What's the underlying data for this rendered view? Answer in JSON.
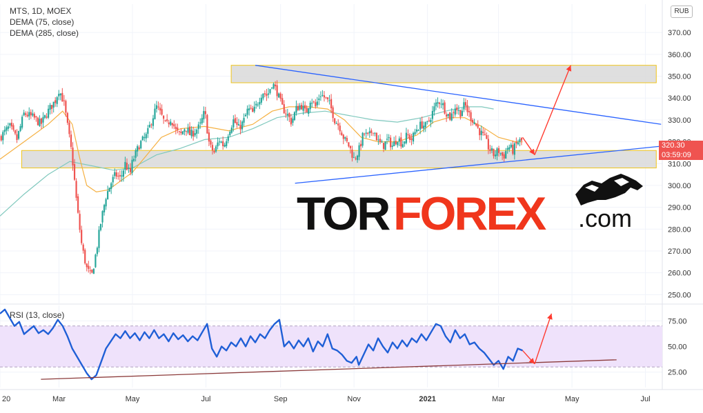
{
  "header": {
    "symbol_line": "MTS, 1D, MOEX",
    "indicator_1": "DEMA (75, close)",
    "indicator_2": "DEMA (285, close)"
  },
  "currency": "RUB",
  "last_price": {
    "value": "320.30",
    "countdown": "03:59:09"
  },
  "watermark": {
    "part1": "TOR",
    "part2": "FOREX",
    "part3": ".com"
  },
  "colors": {
    "candle_up": "#26a69a",
    "candle_down": "#ef5350",
    "dema_fast": "#f5b041",
    "dema_slow": "#7fc8bd",
    "rsi_line": "#1f5fd6",
    "rsi_band": "#efe2fb",
    "trendline": "#2962ff",
    "rsi_trendline": "#8b3a3a",
    "arrow": "#ff3b30",
    "zone_fill": "#d9d9d9",
    "zone_border": "#f0c419",
    "watermark_black": "#111111",
    "watermark_red": "#f0361c"
  },
  "chart_data": [
    {
      "type": "candlestick",
      "title": "MTS, 1D, MOEX",
      "ylabel": "RUB",
      "ylim": [
        246,
        383
      ],
      "y_ticks": [
        250,
        260,
        270,
        280,
        290,
        300,
        310,
        320,
        330,
        340,
        350,
        360,
        370
      ],
      "y_tick_labels": [
        "250.00",
        "260.00",
        "270.00",
        "280.00",
        "290.00",
        "300.00",
        "310.00",
        "320.00",
        "330.00",
        "340.00",
        "350.00",
        "360.00",
        "370.00"
      ],
      "x_ticks": [
        {
          "day": 0,
          "label": "20"
        },
        {
          "day": 49,
          "label": "Mar"
        },
        {
          "day": 110,
          "label": "May"
        },
        {
          "day": 171,
          "label": "Jul"
        },
        {
          "day": 233,
          "label": "Sep"
        },
        {
          "day": 294,
          "label": "Nov"
        },
        {
          "day": 355,
          "label": "2021"
        },
        {
          "day": 414,
          "label": "Mar"
        },
        {
          "day": 475,
          "label": "May"
        },
        {
          "day": 536,
          "label": "Jul"
        }
      ],
      "x_range_days": [
        0,
        550
      ],
      "grid": true,
      "legend": "top-left",
      "close_path": [
        [
          0,
          322
        ],
        [
          8,
          327
        ],
        [
          14,
          321
        ],
        [
          20,
          333
        ],
        [
          28,
          331
        ],
        [
          34,
          328
        ],
        [
          40,
          334
        ],
        [
          46,
          339
        ],
        [
          49,
          344
        ],
        [
          53,
          338
        ],
        [
          57,
          324
        ],
        [
          60,
          313
        ],
        [
          64,
          290
        ],
        [
          68,
          272
        ],
        [
          72,
          262
        ],
        [
          76,
          258
        ],
        [
          80,
          270
        ],
        [
          84,
          284
        ],
        [
          88,
          295
        ],
        [
          92,
          301
        ],
        [
          96,
          305
        ],
        [
          100,
          303
        ],
        [
          104,
          310
        ],
        [
          108,
          305
        ],
        [
          110,
          311
        ],
        [
          116,
          319
        ],
        [
          122,
          323
        ],
        [
          126,
          330
        ],
        [
          130,
          336
        ],
        [
          134,
          332
        ],
        [
          138,
          327
        ],
        [
          142,
          331
        ],
        [
          146,
          325
        ],
        [
          150,
          323
        ],
        [
          154,
          327
        ],
        [
          158,
          323
        ],
        [
          162,
          325
        ],
        [
          166,
          327
        ],
        [
          170,
          334
        ],
        [
          174,
          318
        ],
        [
          178,
          315
        ],
        [
          182,
          321
        ],
        [
          186,
          318
        ],
        [
          190,
          325
        ],
        [
          194,
          330
        ],
        [
          198,
          326
        ],
        [
          202,
          329
        ],
        [
          206,
          335
        ],
        [
          210,
          333
        ],
        [
          214,
          338
        ],
        [
          218,
          343
        ],
        [
          222,
          341
        ],
        [
          226,
          347
        ],
        [
          230,
          343
        ],
        [
          234,
          336
        ],
        [
          238,
          333
        ],
        [
          242,
          329
        ],
        [
          246,
          335
        ],
        [
          250,
          337
        ],
        [
          254,
          333
        ],
        [
          258,
          340
        ],
        [
          262,
          336
        ],
        [
          266,
          342
        ],
        [
          270,
          340
        ],
        [
          274,
          337
        ],
        [
          278,
          330
        ],
        [
          282,
          327
        ],
        [
          286,
          321
        ],
        [
          290,
          318
        ],
        [
          294,
          312
        ],
        [
          298,
          316
        ],
        [
          302,
          324
        ],
        [
          306,
          322
        ],
        [
          310,
          326
        ],
        [
          314,
          320
        ],
        [
          318,
          318
        ],
        [
          322,
          321
        ],
        [
          326,
          318
        ],
        [
          330,
          322
        ],
        [
          334,
          319
        ],
        [
          338,
          323
        ],
        [
          342,
          321
        ],
        [
          346,
          326
        ],
        [
          350,
          328
        ],
        [
          354,
          327
        ],
        [
          358,
          332
        ],
        [
          362,
          337
        ],
        [
          366,
          339
        ],
        [
          370,
          334
        ],
        [
          374,
          331
        ],
        [
          378,
          336
        ],
        [
          382,
          333
        ],
        [
          386,
          337
        ],
        [
          390,
          332
        ],
        [
          394,
          329
        ],
        [
          398,
          325
        ],
        [
          402,
          322
        ],
        [
          406,
          317
        ],
        [
          410,
          314
        ],
        [
          414,
          316
        ],
        [
          418,
          313
        ],
        [
          422,
          318
        ],
        [
          426,
          316
        ],
        [
          430,
          320
        ],
        [
          434,
          320.3
        ]
      ],
      "series": [
        {
          "name": "DEMA (75, close)",
          "points": [
            [
              0,
              312
            ],
            [
              20,
              320
            ],
            [
              40,
              328
            ],
            [
              52,
              334
            ],
            [
              60,
              328
            ],
            [
              66,
              313
            ],
            [
              72,
              300
            ],
            [
              80,
              297
            ],
            [
              90,
              298
            ],
            [
              100,
              302
            ],
            [
              110,
              306
            ],
            [
              122,
              314
            ],
            [
              134,
              322
            ],
            [
              150,
              326
            ],
            [
              170,
              327
            ],
            [
              190,
              325
            ],
            [
              210,
              328
            ],
            [
              226,
              334
            ],
            [
              240,
              336
            ],
            [
              256,
              336
            ],
            [
              272,
              335
            ],
            [
              286,
              330
            ],
            [
              300,
              322
            ],
            [
              314,
              320
            ],
            [
              330,
              320
            ],
            [
              346,
              323
            ],
            [
              360,
              329
            ],
            [
              372,
              331
            ],
            [
              386,
              331
            ],
            [
              400,
              327
            ],
            [
              414,
              322
            ],
            [
              428,
              320
            ],
            [
              434,
              320
            ]
          ]
        },
        {
          "name": "DEMA (285, close)",
          "points": [
            [
              0,
              286
            ],
            [
              20,
              296
            ],
            [
              40,
              305
            ],
            [
              58,
              311
            ],
            [
              76,
              309
            ],
            [
              94,
              307
            ],
            [
              110,
              308
            ],
            [
              130,
              314
            ],
            [
              150,
              317
            ],
            [
              170,
              321
            ],
            [
              190,
              322
            ],
            [
              210,
              326
            ],
            [
              230,
              331
            ],
            [
              250,
              333
            ],
            [
              270,
              334
            ],
            [
              290,
              332
            ],
            [
              310,
              330
            ],
            [
              330,
              329
            ],
            [
              350,
              331
            ],
            [
              370,
              334
            ],
            [
              386,
              336
            ],
            [
              400,
              336
            ],
            [
              410,
              335
            ]
          ]
        }
      ],
      "annotations": {
        "resistance_zone": {
          "x0": 192,
          "x1": 545,
          "y0": 347,
          "y1": 355
        },
        "support_zone": {
          "x0": 18,
          "x1": 545,
          "y0": 308,
          "y1": 316
        },
        "descending_trendline": [
          [
            212,
            355
          ],
          [
            549,
            328
          ]
        ],
        "ascending_trendline": [
          [
            245,
            301
          ],
          [
            550,
            318
          ]
        ],
        "arrow_down": [
          [
            434,
            322
          ],
          [
            444,
            314
          ]
        ],
        "arrow_up": [
          [
            444,
            314
          ],
          [
            474,
            355
          ]
        ]
      }
    },
    {
      "type": "line",
      "title": "RSI (13, close)",
      "ylim": [
        10,
        90
      ],
      "y_ticks": [
        25,
        50,
        75
      ],
      "y_tick_labels": [
        "25.00",
        "50.00",
        "75.00"
      ],
      "band": [
        30,
        70
      ],
      "x_range_days": [
        0,
        550
      ],
      "points": [
        [
          0,
          82
        ],
        [
          4,
          86
        ],
        [
          8,
          78
        ],
        [
          12,
          70
        ],
        [
          16,
          74
        ],
        [
          20,
          62
        ],
        [
          24,
          66
        ],
        [
          28,
          70
        ],
        [
          32,
          63
        ],
        [
          36,
          66
        ],
        [
          40,
          62
        ],
        [
          44,
          68
        ],
        [
          48,
          76
        ],
        [
          52,
          70
        ],
        [
          56,
          60
        ],
        [
          60,
          48
        ],
        [
          64,
          40
        ],
        [
          68,
          32
        ],
        [
          72,
          24
        ],
        [
          76,
          18
        ],
        [
          80,
          22
        ],
        [
          84,
          35
        ],
        [
          88,
          48
        ],
        [
          92,
          55
        ],
        [
          96,
          62
        ],
        [
          100,
          58
        ],
        [
          104,
          65
        ],
        [
          108,
          58
        ],
        [
          112,
          63
        ],
        [
          116,
          56
        ],
        [
          120,
          64
        ],
        [
          124,
          58
        ],
        [
          128,
          66
        ],
        [
          132,
          58
        ],
        [
          136,
          62
        ],
        [
          140,
          55
        ],
        [
          144,
          63
        ],
        [
          148,
          57
        ],
        [
          152,
          61
        ],
        [
          156,
          55
        ],
        [
          160,
          60
        ],
        [
          164,
          56
        ],
        [
          168,
          64
        ],
        [
          172,
          72
        ],
        [
          176,
          48
        ],
        [
          180,
          40
        ],
        [
          184,
          50
        ],
        [
          188,
          46
        ],
        [
          192,
          54
        ],
        [
          196,
          50
        ],
        [
          200,
          58
        ],
        [
          204,
          50
        ],
        [
          208,
          60
        ],
        [
          212,
          54
        ],
        [
          216,
          62
        ],
        [
          220,
          58
        ],
        [
          224,
          66
        ],
        [
          228,
          72
        ],
        [
          232,
          76
        ],
        [
          236,
          50
        ],
        [
          240,
          55
        ],
        [
          244,
          48
        ],
        [
          248,
          56
        ],
        [
          252,
          50
        ],
        [
          256,
          58
        ],
        [
          260,
          45
        ],
        [
          264,
          55
        ],
        [
          268,
          50
        ],
        [
          272,
          62
        ],
        [
          276,
          48
        ],
        [
          280,
          46
        ],
        [
          284,
          42
        ],
        [
          288,
          36
        ],
        [
          292,
          34
        ],
        [
          296,
          40
        ],
        [
          298,
          32
        ],
        [
          302,
          42
        ],
        [
          306,
          52
        ],
        [
          310,
          46
        ],
        [
          314,
          58
        ],
        [
          318,
          50
        ],
        [
          322,
          44
        ],
        [
          326,
          54
        ],
        [
          330,
          48
        ],
        [
          334,
          56
        ],
        [
          338,
          50
        ],
        [
          342,
          58
        ],
        [
          346,
          54
        ],
        [
          350,
          62
        ],
        [
          354,
          56
        ],
        [
          358,
          64
        ],
        [
          362,
          72
        ],
        [
          366,
          70
        ],
        [
          370,
          60
        ],
        [
          374,
          54
        ],
        [
          378,
          66
        ],
        [
          382,
          58
        ],
        [
          386,
          62
        ],
        [
          390,
          52
        ],
        [
          394,
          54
        ],
        [
          398,
          48
        ],
        [
          402,
          44
        ],
        [
          406,
          38
        ],
        [
          410,
          32
        ],
        [
          414,
          36
        ],
        [
          418,
          28
        ],
        [
          422,
          40
        ],
        [
          426,
          36
        ],
        [
          430,
          48
        ],
        [
          434,
          46
        ]
      ],
      "annotations": {
        "trendline": [
          [
            34,
            18
          ],
          [
            512,
            37
          ]
        ],
        "arrow_down": [
          [
            434,
            46
          ],
          [
            444,
            33
          ]
        ],
        "arrow_up": [
          [
            444,
            33
          ],
          [
            458,
            82
          ]
        ]
      }
    }
  ]
}
